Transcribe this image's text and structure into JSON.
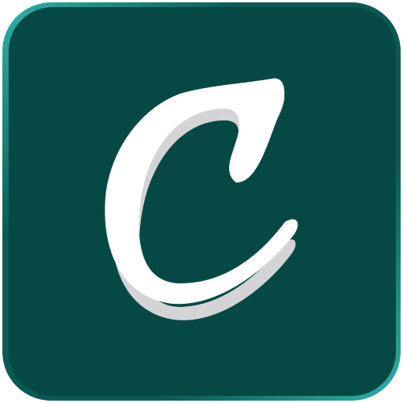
{
  "app_icon": {
    "name": "app-logo",
    "letter": "C",
    "colors": {
      "background": "#064944",
      "edge_highlight": "#2fb3aa",
      "letter": "#ffffff",
      "letter_shadow": "#d4d4d6"
    }
  }
}
